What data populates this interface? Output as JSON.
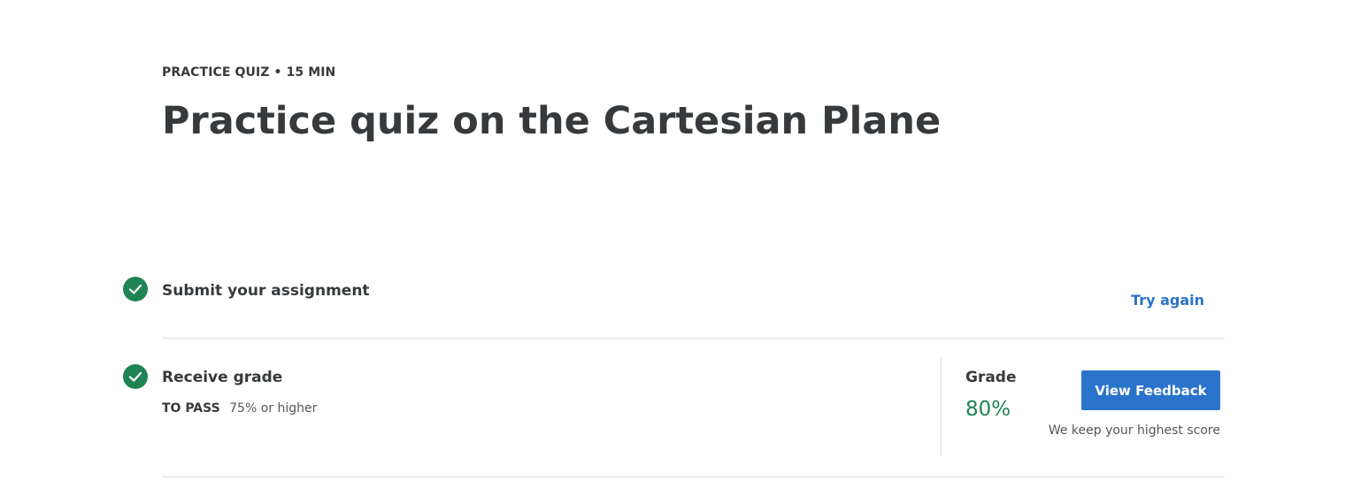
{
  "header": {
    "eyebrow": "PRACTICE QUIZ • 15 MIN",
    "title": "Practice quiz on the Cartesian Plane"
  },
  "steps": {
    "submit": {
      "title": "Submit your assignment",
      "action_label": "Try again",
      "icon": "check-circle-icon"
    },
    "grade": {
      "title": "Receive grade",
      "pass_label": "TO PASS",
      "pass_value": "75% or higher",
      "icon": "check-circle-icon",
      "grade_label": "Grade",
      "grade_value": "80%",
      "feedback_button": "View Feedback",
      "score_note": "We keep your highest score"
    }
  },
  "colors": {
    "success": "#1f8354",
    "accent": "#2a73cc",
    "text": "#373a3c",
    "divider": "#dcdcdc"
  }
}
